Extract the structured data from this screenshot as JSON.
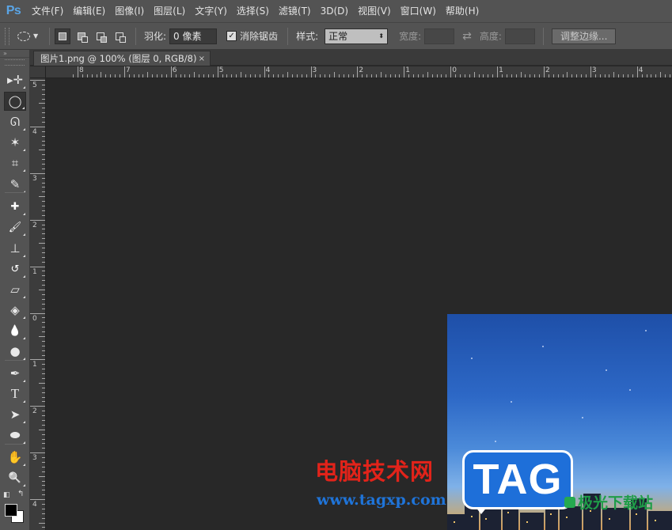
{
  "app": {
    "logo": "Ps",
    "menu": [
      "文件(F)",
      "编辑(E)",
      "图像(I)",
      "图层(L)",
      "文字(Y)",
      "选择(S)",
      "滤镜(T)",
      "3D(D)",
      "视图(V)",
      "窗口(W)",
      "帮助(H)"
    ]
  },
  "options": {
    "feather_label": "羽化:",
    "feather_value": "0 像素",
    "antialias_label": "消除锯齿",
    "antialias_checked": true,
    "style_label": "样式:",
    "style_value": "正常",
    "width_label": "宽度:",
    "height_label": "高度:",
    "refine_button": "调整边缘..."
  },
  "document": {
    "tab_title": "图片1.png @ 100% (图层 0, RGB/8)",
    "close_glyph": "×"
  },
  "rulers": {
    "horizontal_labels": [
      "8",
      "7",
      "6",
      "5",
      "4",
      "3",
      "2",
      "1",
      "0",
      "1",
      "2",
      "3",
      "4"
    ],
    "vertical_labels": [
      "5",
      "4",
      "3",
      "2",
      "1",
      "0",
      "1",
      "2",
      "3",
      "4"
    ]
  },
  "toolbox": {
    "tools": [
      {
        "name": "move-tool",
        "glyph": "▸✛"
      },
      {
        "name": "elliptical-marquee-tool",
        "glyph": "◯",
        "active": true
      },
      {
        "name": "lasso-tool",
        "glyph": "ᘏ"
      },
      {
        "name": "magic-wand-tool",
        "glyph": "✶"
      },
      {
        "name": "crop-tool",
        "glyph": "⌗"
      },
      {
        "name": "eyedropper-tool",
        "glyph": "✎"
      },
      {
        "name": "healing-brush-tool",
        "glyph": "✚"
      },
      {
        "name": "brush-tool",
        "glyph": "🖌"
      },
      {
        "name": "clone-stamp-tool",
        "glyph": "⊥"
      },
      {
        "name": "history-brush-tool",
        "glyph": "↺"
      },
      {
        "name": "eraser-tool",
        "glyph": "▱"
      },
      {
        "name": "paint-bucket-tool",
        "glyph": "◈"
      },
      {
        "name": "blur-tool",
        "glyph": "💧"
      },
      {
        "name": "dodge-tool",
        "glyph": "●"
      },
      {
        "name": "pen-tool",
        "glyph": "✒"
      },
      {
        "name": "type-tool",
        "glyph": "T"
      },
      {
        "name": "path-selection-tool",
        "glyph": "➤"
      },
      {
        "name": "ellipse-shape-tool",
        "glyph": "⬬"
      },
      {
        "name": "hand-tool",
        "glyph": "✋"
      },
      {
        "name": "zoom-tool",
        "glyph": "🔍"
      }
    ],
    "foreground_color": "#000000",
    "background_color": "#ffffff"
  },
  "watermark": {
    "title": "电脑技术网",
    "url": "www.tagxp.com",
    "badge": "TAG",
    "site": "极光下载站"
  },
  "colors": {
    "chrome": "#535353",
    "canvas": "#282828",
    "accent": "#5aa5e6"
  }
}
